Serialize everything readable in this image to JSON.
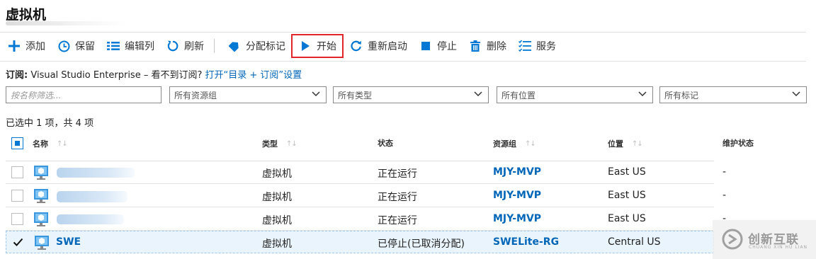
{
  "page": {
    "title": "虚拟机"
  },
  "toolbar": [
    {
      "id": "add",
      "label": "添加",
      "icon": "plus-icon"
    },
    {
      "id": "save",
      "label": "保留",
      "icon": "clock-icon"
    },
    {
      "id": "edit-columns",
      "label": "编辑列",
      "icon": "list-icon"
    },
    {
      "id": "refresh",
      "label": "刷新",
      "icon": "refresh-icon"
    },
    {
      "id": "assign-tags",
      "label": "分配标记",
      "icon": "tag-icon"
    },
    {
      "id": "start",
      "label": "开始",
      "icon": "play-icon",
      "highlighted": true
    },
    {
      "id": "restart",
      "label": "重新启动",
      "icon": "restart-icon"
    },
    {
      "id": "stop",
      "label": "停止",
      "icon": "stop-icon"
    },
    {
      "id": "delete",
      "label": "删除",
      "icon": "trash-icon"
    },
    {
      "id": "services",
      "label": "服务",
      "icon": "services-icon"
    }
  ],
  "subscription": {
    "label": "订阅:",
    "value": "Visual Studio Enterprise – 看不到订阅?",
    "link": "打开“目录 + 订阅”设置"
  },
  "filters": {
    "search_placeholder": "按名称筛选...",
    "resource_group": "所有资源组",
    "type": "所有类型",
    "location": "所有位置",
    "tags": "所有标记"
  },
  "selection_count": "已选中 1 项，共 4 项",
  "columns": {
    "name": "名称",
    "type": "类型",
    "status": "状态",
    "resource_group": "资源组",
    "location": "位置",
    "maintenance": "维护状态"
  },
  "rows": [
    {
      "name": "",
      "type": "虚拟机",
      "status": "正在运行",
      "resource_group": "MJY-MVP",
      "location": "East US",
      "maintenance": "-",
      "selected": false
    },
    {
      "name": "",
      "type": "虚拟机",
      "status": "正在运行",
      "resource_group": "MJY-MVP",
      "location": "East US",
      "maintenance": "-",
      "selected": false
    },
    {
      "name": "",
      "type": "虚拟机",
      "status": "正在运行",
      "resource_group": "MJY-MVP",
      "location": "East US",
      "maintenance": "-",
      "selected": false
    },
    {
      "name": "SWE",
      "type": "虚拟机",
      "status": "已停止(已取消分配)",
      "resource_group": "SWELite-RG",
      "location": "Central US",
      "maintenance": "",
      "selected": true
    }
  ],
  "watermark": {
    "text": "创新互联",
    "sub": "CHUANG XIN HU LIAN"
  },
  "colors": {
    "accent": "#0078d4",
    "link": "#0066b8",
    "highlight_border": "#e0262b",
    "selected_row": "#e9f4fc"
  }
}
